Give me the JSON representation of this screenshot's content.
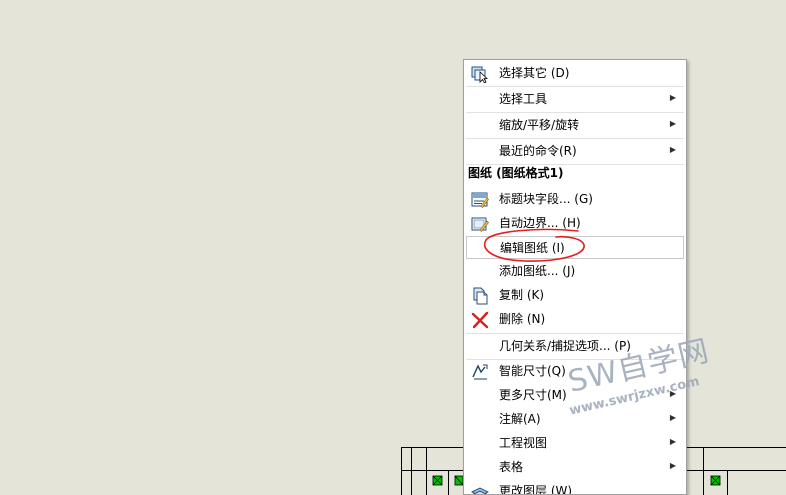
{
  "context_menu": {
    "items": [
      {
        "label": "选择其它 (D)",
        "icon": "select-other-icon",
        "submenu": false
      },
      {
        "label": "选择工具",
        "icon": "",
        "submenu": true
      },
      {
        "label": "缩放/平移/旋转",
        "icon": "",
        "submenu": true
      },
      {
        "label": "最近的命令(R)",
        "icon": "",
        "submenu": true
      },
      {
        "label": "标题块字段... (G)",
        "icon": "title-block-icon",
        "submenu": false
      },
      {
        "label": "自动边界... (H)",
        "icon": "auto-border-icon",
        "submenu": false
      },
      {
        "label": "编辑图纸 (I)",
        "icon": "",
        "submenu": false
      },
      {
        "label": "添加图纸... (J)",
        "icon": "",
        "submenu": false
      },
      {
        "label": "复制 (K)",
        "icon": "copy-icon",
        "submenu": false
      },
      {
        "label": "删除 (N)",
        "icon": "delete-icon",
        "submenu": false
      },
      {
        "label": "几何关系/捕捉选项... (P)",
        "icon": "",
        "submenu": false
      },
      {
        "label": "智能尺寸(Q)",
        "icon": "smart-dimension-icon",
        "submenu": false
      },
      {
        "label": "更多尺寸(M)",
        "icon": "",
        "submenu": true
      },
      {
        "label": "注解(A)",
        "icon": "",
        "submenu": true
      },
      {
        "label": "工程视图",
        "icon": "",
        "submenu": true
      },
      {
        "label": "表格",
        "icon": "",
        "submenu": true
      },
      {
        "label": "更改图层 (W)",
        "icon": "change-layer-icon",
        "submenu": false
      }
    ],
    "section_header": "图纸 (图纸格式1)",
    "highlighted_item": "编辑图纸 (I)"
  },
  "watermark": {
    "main": "SW自学网",
    "sub": "www.swrjzxw.com"
  },
  "colors": {
    "background": "#e4e4d8",
    "annotation": "#e02020",
    "marker": "#00c000",
    "watermark": "#9aa6b8"
  }
}
